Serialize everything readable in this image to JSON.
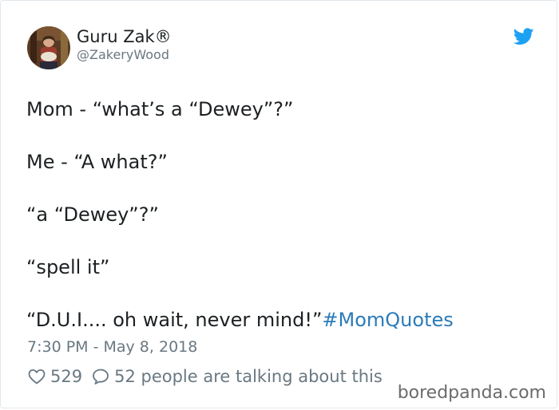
{
  "author": {
    "display_name": "Guru Zak®",
    "handle": "@ZakeryWood"
  },
  "tweet": {
    "lines": [
      "Mom - “what’s a “Dewey”?”",
      "Me - “A what?”",
      "“a “Dewey”?”",
      "“spell it”",
      "“D.U.I.... oh wait, never mind!”"
    ],
    "hashtag": "#MomQuotes",
    "timestamp": "7:30 PM - May 8, 2018"
  },
  "engagement": {
    "likes": "529",
    "replies": "52 people are talking about this"
  },
  "watermark": "boredpanda.com",
  "icons": {
    "brand": "twitter-bird-icon",
    "like": "heart-icon",
    "reply": "speech-bubble-icon"
  },
  "colors": {
    "text": "#1c2022",
    "secondary": "#697882",
    "hashtag": "#2b7bb9",
    "twitter_blue": "#1da1f2"
  }
}
